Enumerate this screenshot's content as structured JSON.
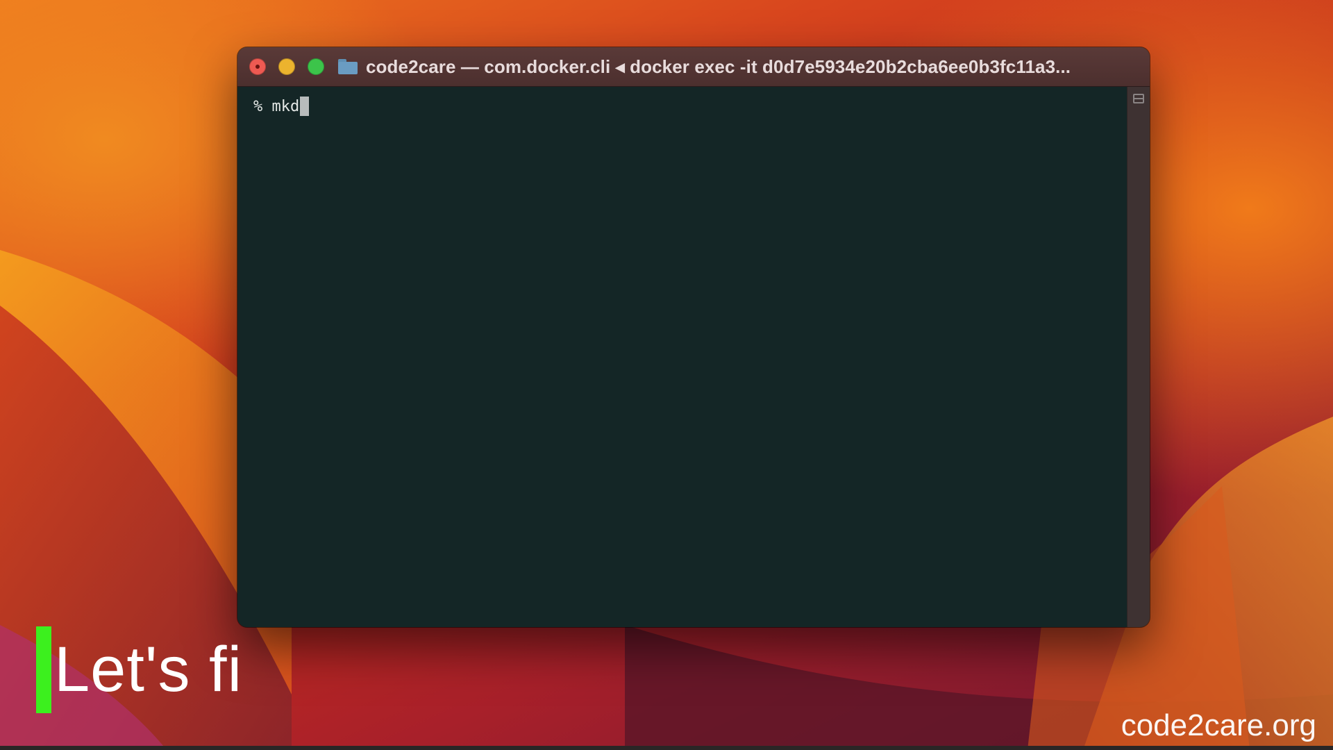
{
  "window": {
    "title": "code2care — com.docker.cli ◂ docker exec -it d0d7e5934e20b2cba6ee0b3fc11a3...",
    "folder_icon": "folder-icon"
  },
  "terminal": {
    "prompt": "%",
    "command": "mkd"
  },
  "caption": {
    "text": "Let's fi",
    "accent_color": "#3cf01e"
  },
  "watermark": {
    "text": "code2care.org"
  },
  "colors": {
    "terminal_bg": "#142626",
    "titlebar_bg": "#4c2f2e",
    "close": "#ee5a52",
    "minimize": "#ecb32e",
    "maximize": "#3cc44a"
  }
}
